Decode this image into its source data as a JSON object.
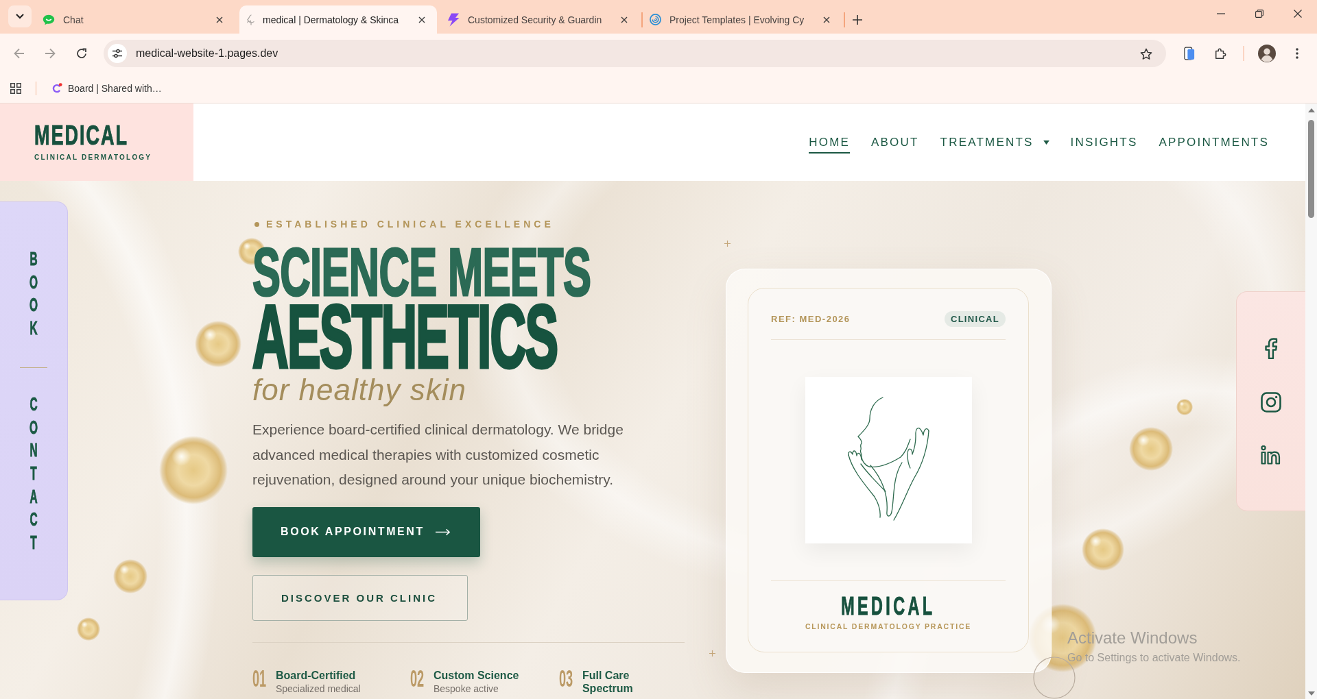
{
  "browser": {
    "tabs": [
      {
        "title": "Chat",
        "selected": false
      },
      {
        "title": "medical | Dermatology & Skinca",
        "selected": true
      },
      {
        "title": "Customized Security & Guardin",
        "selected": false
      },
      {
        "title": "Project Templates | Evolving Cy",
        "selected": false
      }
    ],
    "back": {
      "disabled": true
    },
    "forward": {
      "disabled": true
    },
    "url": "medical-website-1.pages.dev",
    "bookmarks": [
      {
        "label": "Board | Shared with…"
      }
    ]
  },
  "header": {
    "logo": {
      "title": "MEDICAL",
      "subtitle": "CLINICAL DERMATOLOGY"
    },
    "nav": [
      {
        "label": "HOME",
        "selected": true,
        "has_menu": false
      },
      {
        "label": "ABOUT",
        "selected": false,
        "has_menu": false
      },
      {
        "label": "TREATMENTS",
        "selected": false,
        "has_menu": true
      },
      {
        "label": "INSIGHTS",
        "selected": false,
        "has_menu": false
      },
      {
        "label": "APPOINTMENTS",
        "selected": false,
        "has_menu": false
      }
    ]
  },
  "side_tab": {
    "links": [
      "BOOK",
      "CONTACT"
    ]
  },
  "hero": {
    "eyebrow": "ESTABLISHED CLINICAL EXCELLENCE",
    "title": {
      "line_1": "SCIENCE MEETS",
      "line_2": "AESTHETICS"
    },
    "tagline": "for healthy skin",
    "description": "Experience board-certified clinical dermatology. We bridge advanced medical therapies with customized cosmetic rejuvenation, designed around your unique biochemistry.",
    "buttons": [
      {
        "label": "BOOK APPOINTMENT",
        "kind": "primary"
      },
      {
        "label": "DISCOVER OUR CLINIC",
        "kind": "outline"
      }
    ],
    "features": [
      {
        "number": "01",
        "title": "Board-Certified",
        "subtitle": "Specialized medical"
      },
      {
        "number": "02",
        "title": "Custom Science",
        "subtitle": "Bespoke active"
      },
      {
        "number": "03",
        "title": "Full Care Spectrum"
      }
    ]
  },
  "card": {
    "reference": "REF: MED-2026",
    "badge": "CLINICAL",
    "title": "MEDICAL",
    "subtitle": "CLINICAL DERMATOLOGY PRACTICE"
  },
  "social_links": [
    {
      "kind": "facebook"
    },
    {
      "kind": "instagram"
    },
    {
      "kind": "linkedin"
    }
  ],
  "os_notice": {
    "title": "Activate Windows",
    "subtitle": "Go to Settings to activate Windows."
  }
}
